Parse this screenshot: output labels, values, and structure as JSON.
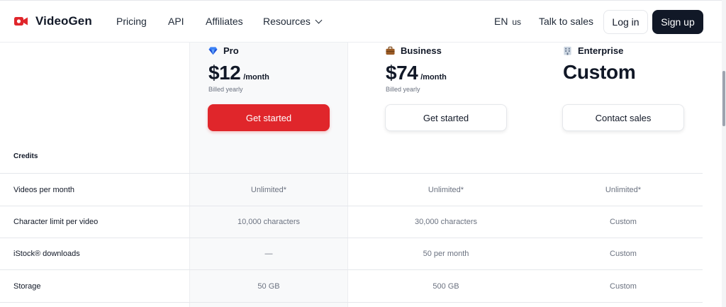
{
  "nav": {
    "brand": "VideoGen",
    "links": [
      "Pricing",
      "API",
      "Affiliates",
      "Resources"
    ],
    "lang": "EN",
    "lang_region": "us",
    "talk": "Talk to sales",
    "login": "Log in",
    "signup": "Sign up"
  },
  "plans": [
    {
      "name": "Pro",
      "icon": "gem-icon",
      "price": "$12",
      "period": "/month",
      "billed": "Billed yearly",
      "cta": "Get started"
    },
    {
      "name": "Business",
      "icon": "briefcase-icon",
      "price": "$74",
      "period": "/month",
      "billed": "Billed yearly",
      "cta": "Get started"
    },
    {
      "name": "Enterprise",
      "icon": "building-icon",
      "price": "Custom",
      "cta": "Contact sales"
    }
  ],
  "table": {
    "section": "Credits",
    "rows": [
      {
        "feature": "Videos per month",
        "values": [
          "Unlimited*",
          "Unlimited*",
          "Unlimited*"
        ]
      },
      {
        "feature": "Character limit per video",
        "values": [
          "10,000 characters",
          "30,000 characters",
          "Custom"
        ]
      },
      {
        "feature": "iStock® downloads",
        "values": [
          "—",
          "50 per month",
          "Custom"
        ]
      },
      {
        "feature": "Storage",
        "values": [
          "50 GB",
          "500 GB",
          "Custom"
        ]
      }
    ]
  },
  "colors": {
    "accent": "#e0262b",
    "dark": "#111827",
    "muted": "#6b7280"
  }
}
